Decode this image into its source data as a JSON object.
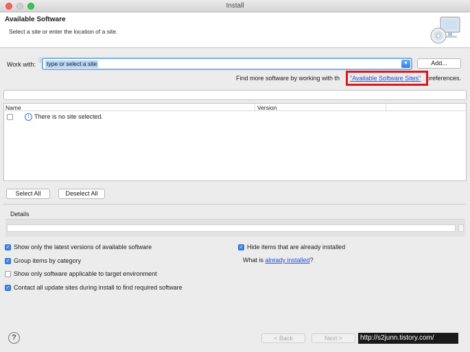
{
  "window": {
    "title": "Install"
  },
  "header": {
    "title": "Available Software",
    "description": "Select a site or enter the location of a site.",
    "icon": "monitor-cd-icon"
  },
  "work_with": {
    "label": "Work with:",
    "value": "type or select a site",
    "add_label": "Add..."
  },
  "find_more": {
    "prefix": "Find more software by working with th",
    "link": "\"Available Software Sites\"",
    "suffix": "preferences."
  },
  "table": {
    "columns": [
      "Name",
      "Version"
    ],
    "empty_message": "There is no site selected."
  },
  "buttons": {
    "select_all": "Select All",
    "deselect_all": "Deselect All"
  },
  "details": {
    "label": "Details"
  },
  "options": {
    "latest_versions": {
      "label": "Show only the latest versions of available software",
      "checked": true
    },
    "group_by_category": {
      "label": "Group items by category",
      "checked": true
    },
    "target_env": {
      "label": "Show only software applicable to target environment",
      "checked": false
    },
    "contact_sites": {
      "label": "Contact all update sites during install to find required software",
      "checked": true
    },
    "hide_installed": {
      "label": "Hide items that are already installed",
      "checked": true
    }
  },
  "what_is": {
    "prefix": "What is ",
    "link": "already installed",
    "suffix": "?"
  },
  "footer": {
    "back": "< Back",
    "next": "Next >",
    "watermark": "http://s2junn.tistory.com/"
  },
  "colors": {
    "accent": "#3b86e6",
    "link": "#1e52d6",
    "highlight": "#e0141a"
  }
}
